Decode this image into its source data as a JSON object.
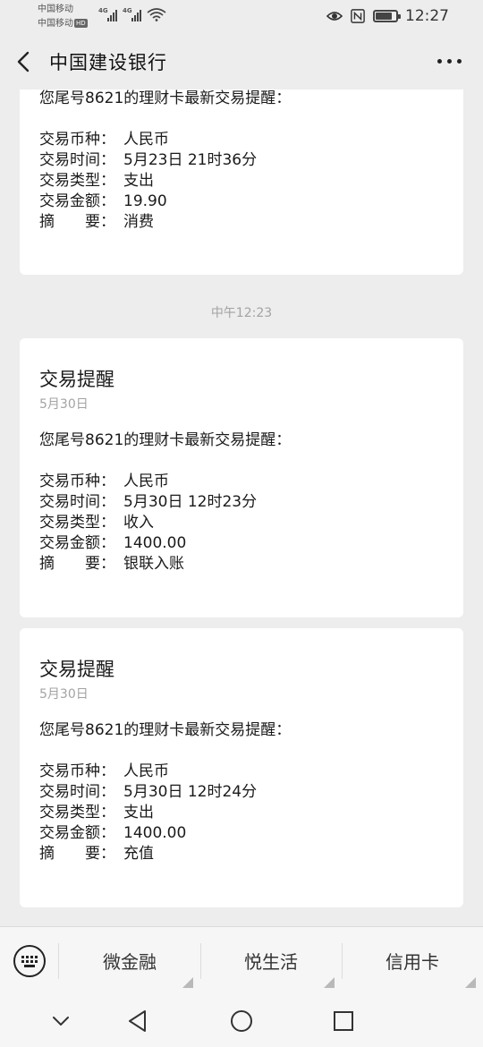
{
  "status_bar": {
    "carrier1": "中国移动",
    "carrier2": "中国移动",
    "hd": "HD",
    "net1": "4G",
    "net2": "4G",
    "time": "12:27",
    "battery_percent": 80
  },
  "header": {
    "title": "中国建设银行"
  },
  "messages": [
    {
      "intro": "您尾号8621的理财卡最新交易提醒：",
      "rows": [
        {
          "k": "交易币种：",
          "v": "人民币"
        },
        {
          "k": "交易时间：",
          "v": "5月23日 21时36分"
        },
        {
          "k": "交易类型：",
          "v": "支出"
        },
        {
          "k": "交易金额：",
          "v": "19.90"
        },
        {
          "k": "摘　　要：",
          "v": "消费"
        }
      ]
    },
    {
      "title": "交易提醒",
      "date": "5月30日",
      "intro": "您尾号8621的理财卡最新交易提醒：",
      "rows": [
        {
          "k": "交易币种：",
          "v": "人民币"
        },
        {
          "k": "交易时间：",
          "v": "5月30日 12时23分"
        },
        {
          "k": "交易类型：",
          "v": "收入"
        },
        {
          "k": "交易金额：",
          "v": "1400.00"
        },
        {
          "k": "摘　　要：",
          "v": "银联入账"
        }
      ]
    },
    {
      "title": "交易提醒",
      "date": "5月30日",
      "intro": "您尾号8621的理财卡最新交易提醒：",
      "rows": [
        {
          "k": "交易币种：",
          "v": "人民币"
        },
        {
          "k": "交易时间：",
          "v": "5月30日 12时24分"
        },
        {
          "k": "交易类型：",
          "v": "支出"
        },
        {
          "k": "交易金额：",
          "v": "1400.00"
        },
        {
          "k": "摘　　要：",
          "v": "充值"
        }
      ]
    }
  ],
  "timestamp": "中午12:23",
  "bottom_menu": [
    "微金融",
    "悦生活",
    "信用卡"
  ]
}
